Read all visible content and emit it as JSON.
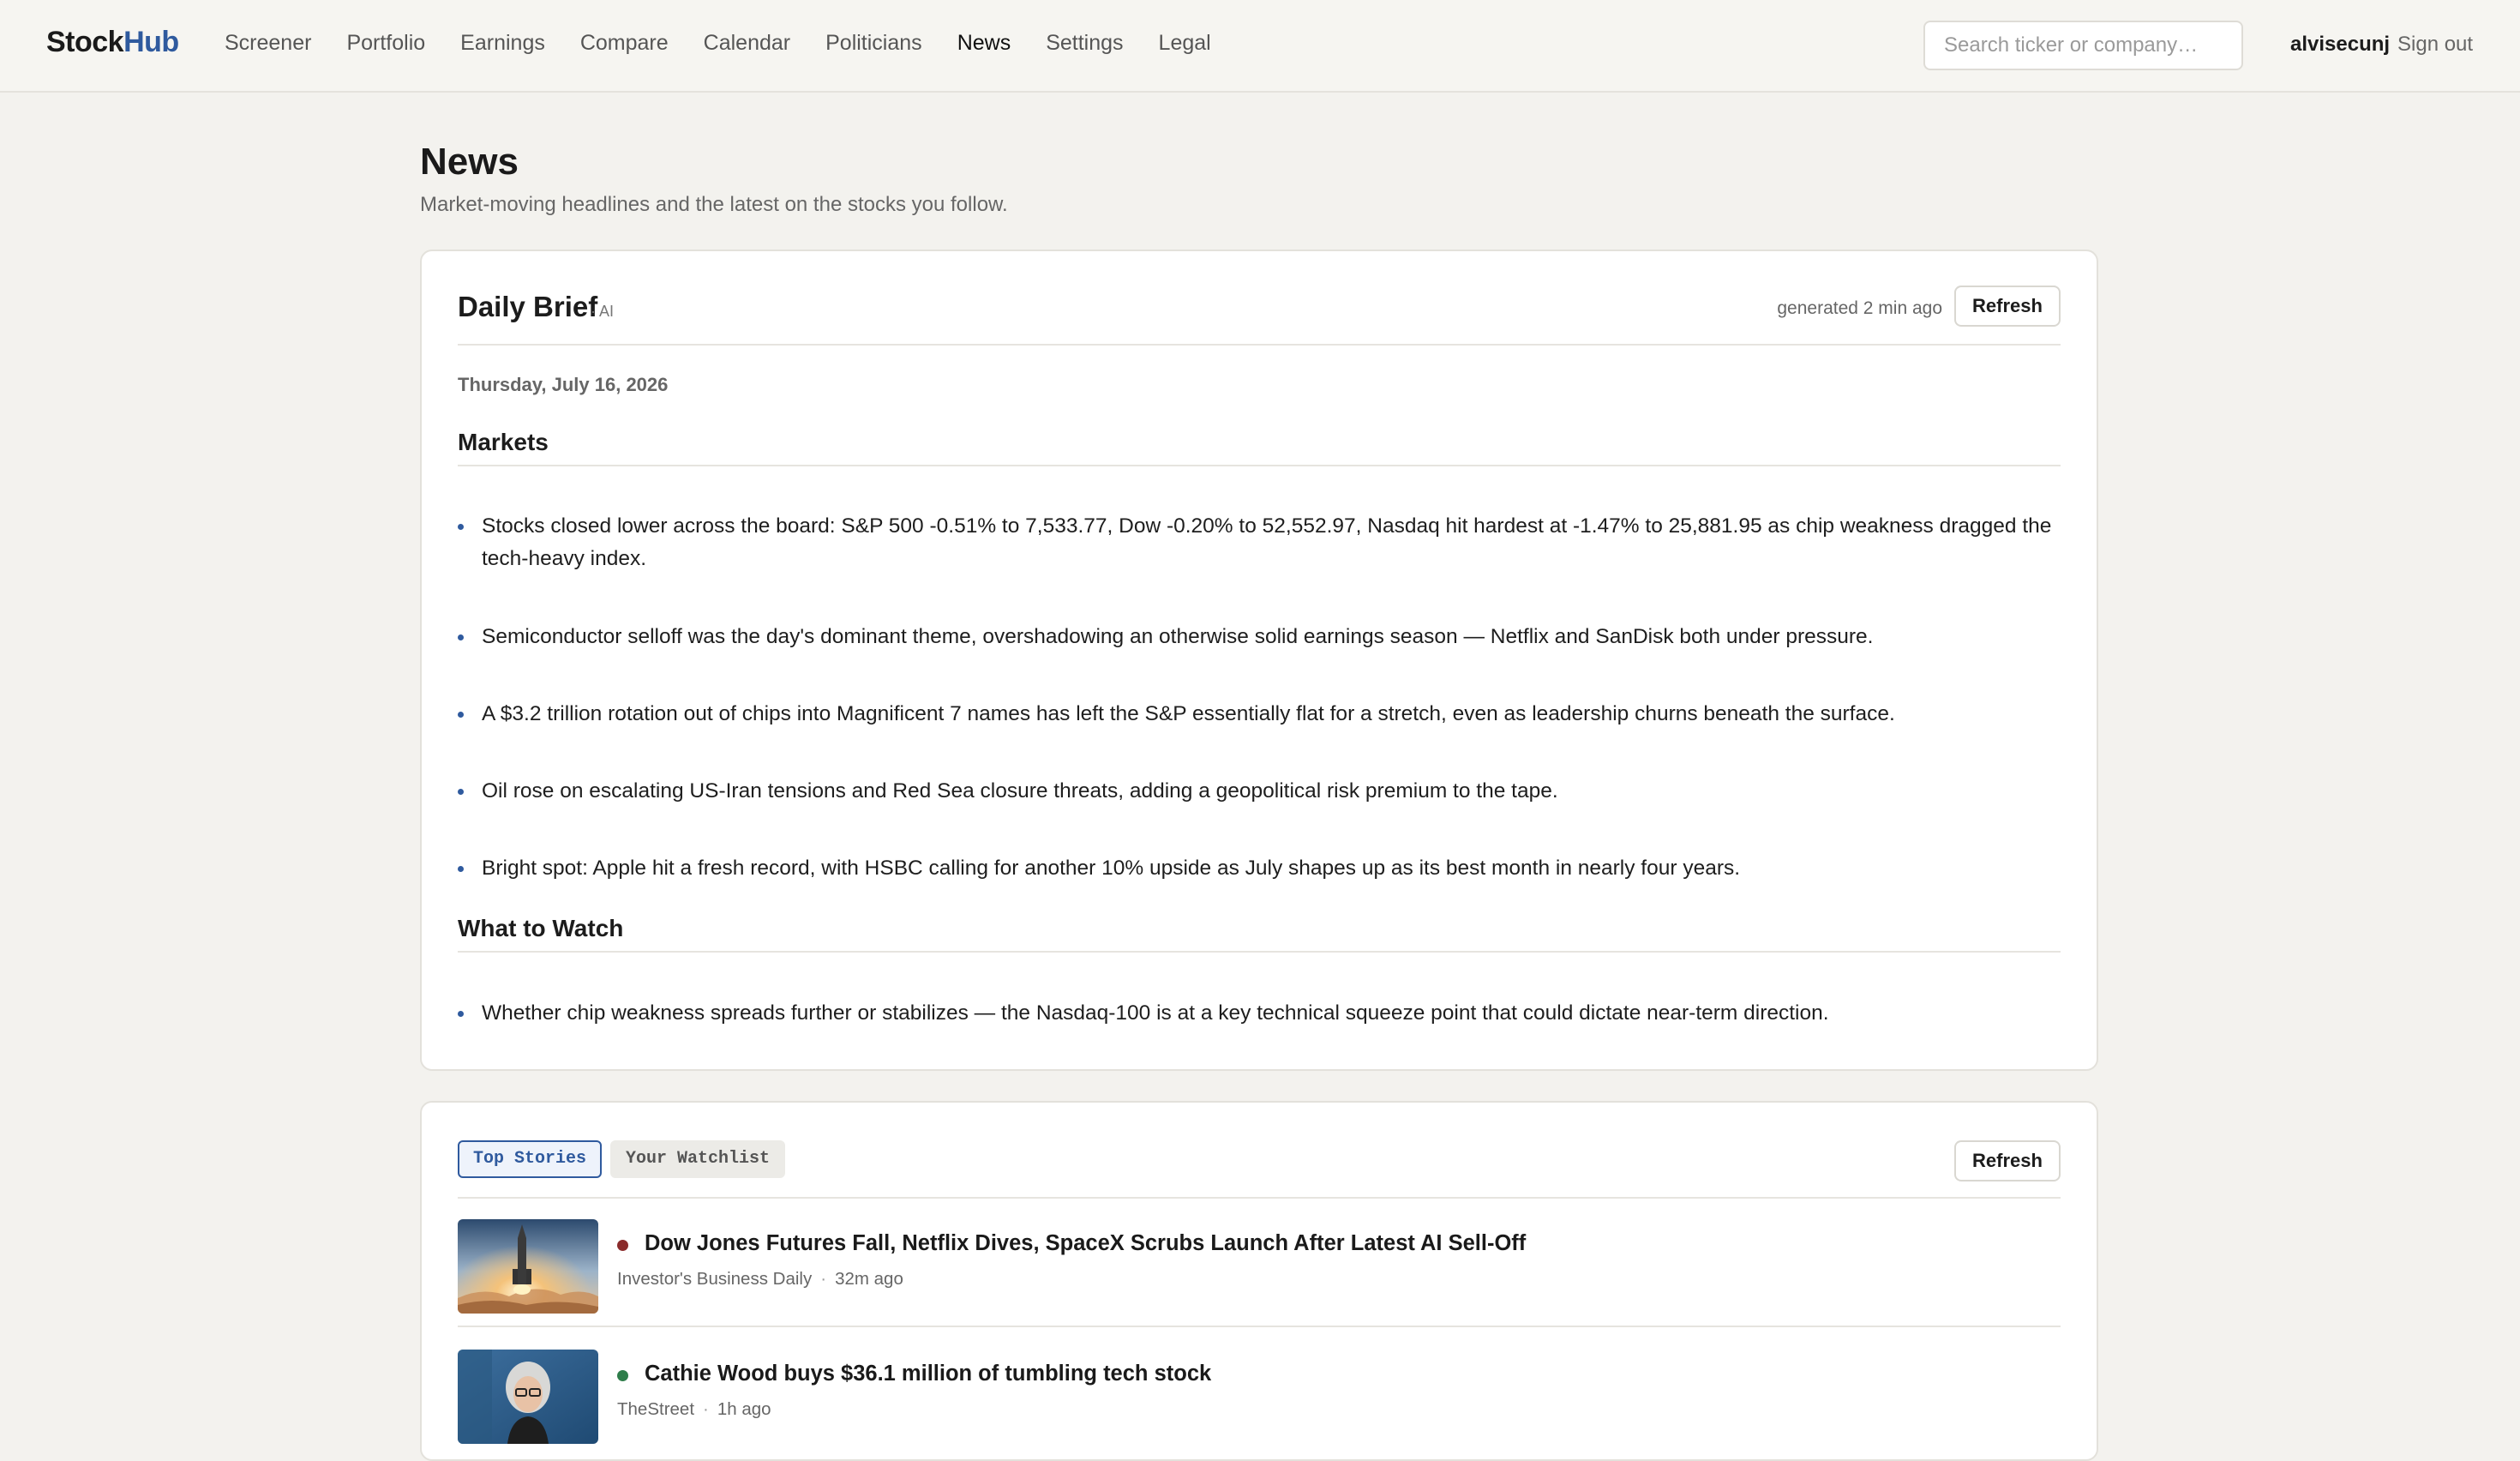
{
  "app": {
    "logo_part1": "Stock",
    "logo_part2": "Hub",
    "accent_color": "#2f5a9e"
  },
  "nav": {
    "items": [
      {
        "label": "Screener"
      },
      {
        "label": "Portfolio"
      },
      {
        "label": "Earnings"
      },
      {
        "label": "Compare"
      },
      {
        "label": "Calendar"
      },
      {
        "label": "Politicians"
      },
      {
        "label": "News",
        "active": true
      },
      {
        "label": "Settings"
      },
      {
        "label": "Legal"
      }
    ],
    "search_placeholder": "Search ticker or company…",
    "search_value": "",
    "username": "alvisecunj",
    "signout": "Sign out"
  },
  "page": {
    "title": "News",
    "subtitle": "Market-moving headlines and the latest on the stocks you follow."
  },
  "brief": {
    "title": "Daily Brief",
    "tag": "· AI",
    "generated": "generated 2 min ago",
    "refresh": "Refresh",
    "date": "Thursday, July 16, 2026",
    "sections": [
      {
        "heading": "Markets",
        "bullets": [
          "Stocks closed lower across the board: S&P 500 -0.51% to 7,533.77, Dow -0.20% to 52,552.97, Nasdaq hit hardest at -1.47% to 25,881.95 as chip weakness dragged the tech-heavy index.",
          "Semiconductor selloff was the day's dominant theme, overshadowing an otherwise solid earnings season — Netflix and SanDisk both under pressure.",
          "A $3.2 trillion rotation out of chips into Magnificent 7 names has left the S&P essentially flat for a stretch, even as leadership churns beneath the surface.",
          "Oil rose on escalating US-Iran tensions and Red Sea closure threats, adding a geopolitical risk premium to the tape.",
          "Bright spot: Apple hit a fresh record, with HSBC calling for another 10% upside as July shapes up as its best month in nearly four years."
        ]
      },
      {
        "heading": "What to Watch",
        "bullets": [
          "Whether chip weakness spreads further or stabilizes — the Nasdaq-100 is at a key technical squeeze point that could dictate near-term direction."
        ]
      }
    ]
  },
  "news": {
    "tabs": [
      {
        "label": "Top Stories",
        "active": true
      },
      {
        "label": "Your Watchlist",
        "active": false
      }
    ],
    "refresh": "Refresh",
    "stories": [
      {
        "title": "Dow Jones Futures Fall, Netflix Dives, SpaceX Scrubs Launch After Latest AI Sell-Off",
        "source": "Investor's Business Daily",
        "time": "32m ago",
        "sentiment_color": "#8a2b2b",
        "thumb_icon": "rocket-launch-image"
      },
      {
        "title": "Cathie Wood buys $36.1 million of tumbling tech stock",
        "source": "TheStreet",
        "time": "1h ago",
        "sentiment_color": "#2e7d4a",
        "thumb_icon": "person-portrait-image"
      }
    ]
  }
}
